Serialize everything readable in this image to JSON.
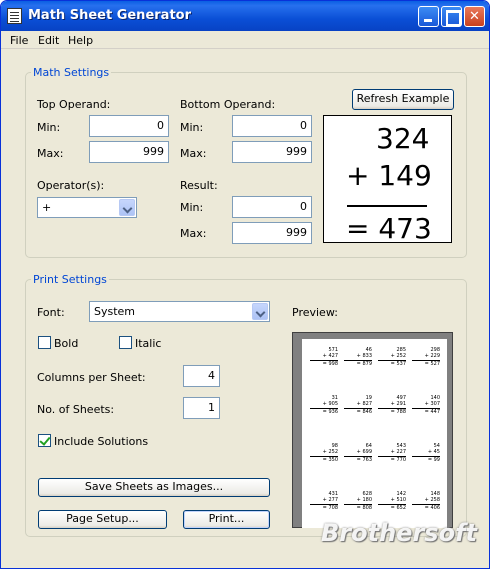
{
  "window": {
    "title": "Math Sheet Generator",
    "close_glyph": "✕"
  },
  "menu": {
    "items": [
      "File",
      "Edit",
      "Help"
    ]
  },
  "math_settings": {
    "legend": "Math Settings",
    "top_operand": {
      "label": "Top Operand:",
      "min_label": "Min:",
      "min": "0",
      "max_label": "Max:",
      "max": "999"
    },
    "bottom_operand": {
      "label": "Bottom Operand:",
      "min_label": "Min:",
      "min": "0",
      "max_label": "Max:",
      "max": "999"
    },
    "operators": {
      "label": "Operator(s):",
      "selected": "+"
    },
    "result": {
      "label": "Result:",
      "min_label": "Min:",
      "min": "0",
      "max_label": "Max:",
      "max": "999"
    },
    "refresh_label": "Refresh Example",
    "example": {
      "top": "324",
      "bottom": "+ 149",
      "result": "= 473"
    }
  },
  "print_settings": {
    "legend": "Print Settings",
    "font_label": "Font:",
    "font_value": "System",
    "bold_label": "Bold",
    "bold_checked": false,
    "italic_label": "Italic",
    "italic_checked": false,
    "columns_label": "Columns per Sheet:",
    "columns_value": "4",
    "sheets_label": "No. of Sheets:",
    "sheets_value": "1",
    "solutions_label": "Include Solutions",
    "solutions_checked": true,
    "save_images_label": "Save Sheets as Images...",
    "page_setup_label": "Page Setup...",
    "print_label": "Print...",
    "preview_label": "Preview:",
    "preview_problems": [
      [
        "571",
        "+ 427",
        "= 998"
      ],
      [
        "46",
        "+ 833",
        "= 879"
      ],
      [
        "285",
        "+ 252",
        "= 537"
      ],
      [
        "298",
        "+ 229",
        "= 527"
      ],
      [
        "31",
        "+ 905",
        "= 936"
      ],
      [
        "19",
        "+ 827",
        "= 846"
      ],
      [
        "497",
        "+ 291",
        "= 788"
      ],
      [
        "140",
        "+ 307",
        "= 447"
      ],
      [
        "98",
        "+ 252",
        "= 350"
      ],
      [
        "64",
        "+ 699",
        "= 763"
      ],
      [
        "543",
        "+ 227",
        "= 770"
      ],
      [
        "54",
        "+ 45",
        "= 99"
      ],
      [
        "431",
        "+ 277",
        "= 708"
      ],
      [
        "628",
        "+ 180",
        "= 808"
      ],
      [
        "142",
        "+ 510",
        "= 652"
      ],
      [
        "148",
        "+ 258",
        "= 406"
      ]
    ]
  },
  "watermark": "Brothersoft",
  "colors": {
    "title_bar": "#0a4fd6",
    "group_legend": "#0046d5",
    "window_bg": "#ece9d8"
  }
}
